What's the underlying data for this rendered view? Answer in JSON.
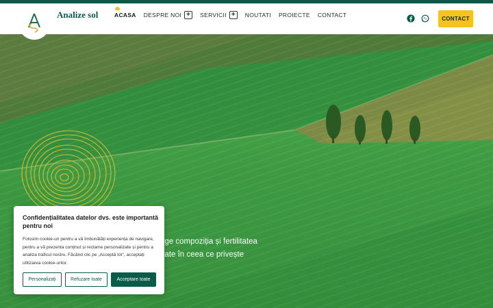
{
  "brand": {
    "name": "Analize sol"
  },
  "nav": {
    "items": [
      {
        "label": "ACASA"
      },
      {
        "label": "DESPRE NOI"
      },
      {
        "label": "SERVICII"
      },
      {
        "label": "NOUTATI"
      },
      {
        "label": "PROIECTE"
      },
      {
        "label": "CONTACT"
      }
    ],
    "plus": "+"
  },
  "header": {
    "contact_button": "CONTACT"
  },
  "icons": {
    "social": [
      "facebook-icon",
      "whatsapp-icon"
    ]
  },
  "hero": {
    "line1": "ege compoziția și fertilitatea",
    "line2": "nate în ceea ce privește"
  },
  "cookie": {
    "title": "Confidențialitatea datelor dvs. este importantă pentru noi",
    "text": "Folosim cookie-uri pentru a vă îmbunătăți experiența de navigare, pentru a vă prezenta conținut și reclame personalizate și pentru a analiza traficul nostru. Făcând clic pe „Acceptă tot”, acceptați utilizarea cookie-urilor.",
    "buttons": {
      "customize": "Personalizați",
      "reject": "Refuzare toate",
      "accept": "Acceptare toate"
    }
  },
  "colors": {
    "brand_green": "#0b5b49",
    "accent_yellow": "#f6c21f",
    "field_green": "#3f8a3a"
  }
}
